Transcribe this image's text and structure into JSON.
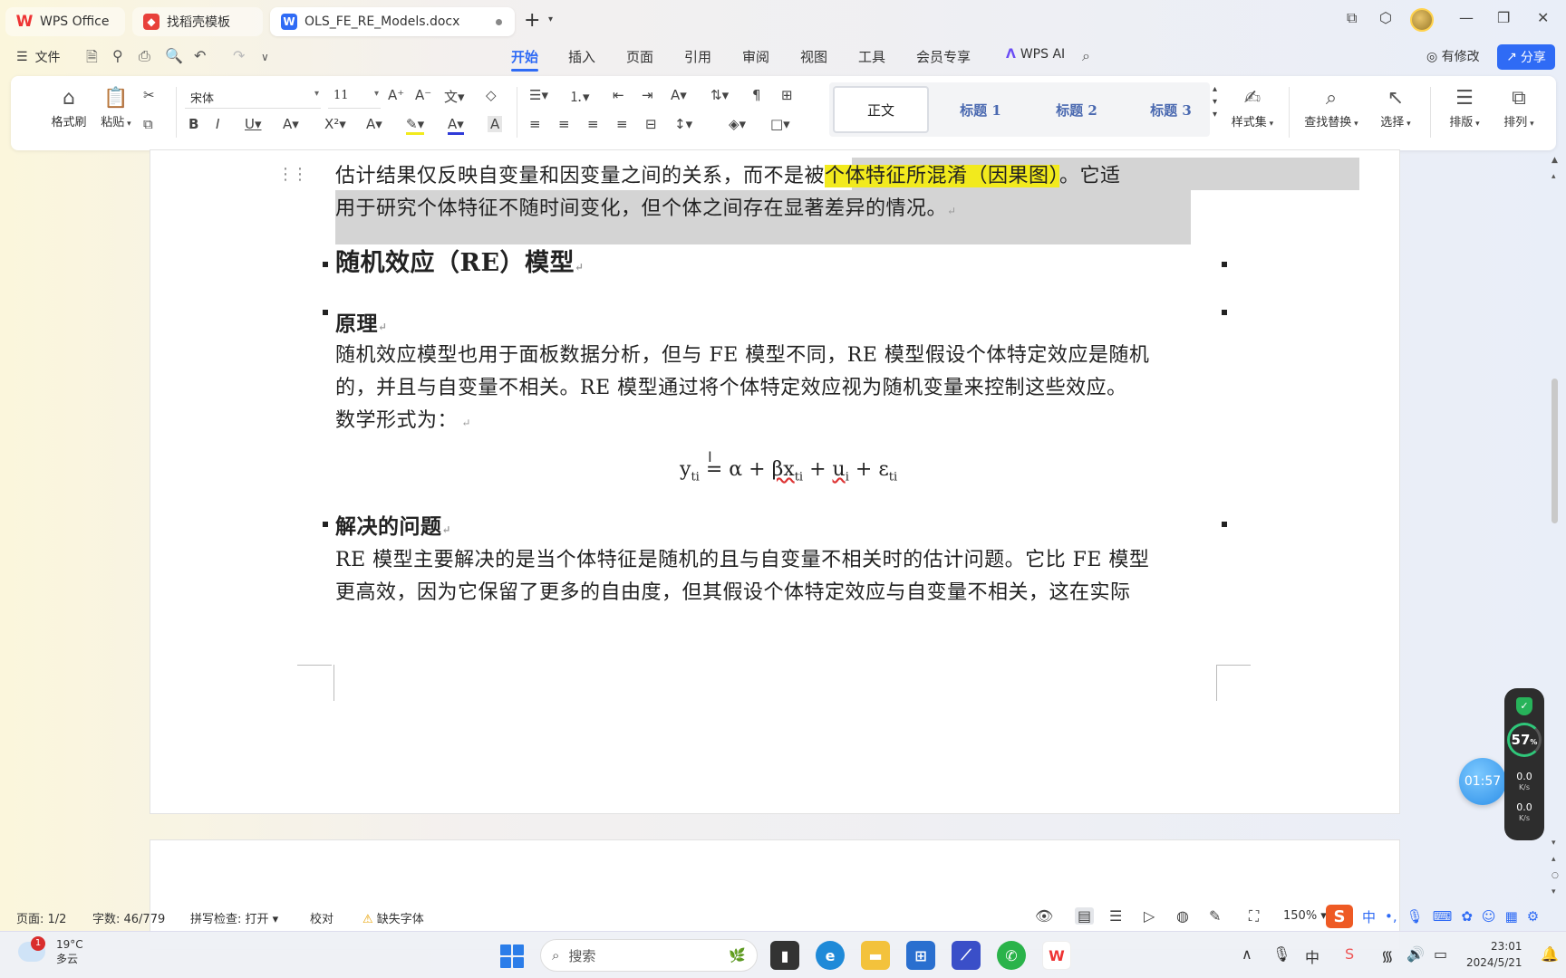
{
  "titlebar": {
    "tabs": [
      {
        "label": "WPS Office"
      },
      {
        "label": "找稻壳模板"
      },
      {
        "label": "OLS_FE_RE_Models.docx"
      }
    ],
    "new_tab": "+"
  },
  "menubar": {
    "file_label": "文件",
    "tabs": [
      "开始",
      "插入",
      "页面",
      "引用",
      "审阅",
      "视图",
      "工具",
      "会员专享"
    ],
    "ai_label": "WPS AI",
    "revise_label": "有修改",
    "share_label": "分享"
  },
  "ribbon": {
    "format_painter": "格式刷",
    "paste": "粘贴",
    "font_name": "宋体",
    "font_size": "11",
    "styles": [
      "正文",
      "标题 1",
      "标题 2",
      "标题 3"
    ],
    "style_set": "样式集",
    "find_replace": "查找替换",
    "select": "选择",
    "typeset": "排版",
    "arrange": "排列"
  },
  "document": {
    "line1_a": "估计结果仅反映自变量和因变量之间的关系，而不是",
    "line1_b": "被",
    "line1_highlight": "个体特征所混淆（因果图）",
    "line1_c": "。它适",
    "line2": "用于研究个体特征不随时间变化，但个体之间存在显著差异的情况。",
    "heading_re": "随机效应（RE）模型",
    "heading_principle": "原理",
    "p1_line1": "随机效应模型也用于面板数据分析，但与 FE 模型不同，RE 模型假设个体特定效应是随机",
    "p1_line2": "的，并且与自变量不相关。RE 模型通过将个体特定效应视为随机变量来控制这些效应。",
    "p1_line3": "数学形式为：",
    "heading_problem": "解决的问题",
    "p2_line1": "RE 模型主要解决的是当个体特征是随机的且与自变量不相关时的估计问题。它比 FE 模型",
    "p2_line2": "更高效，因为它保留了更多的自由度，但其假设个体特定效应与自变量不相关，这在实际"
  },
  "formula": {
    "y": "y",
    "y_sub": "ti",
    "eq": "=",
    "alpha": "α",
    "plus": "+",
    "beta_x": "βx",
    "x_sub": "ti",
    "u": "u",
    "u_sub": "i",
    "eps": "ε",
    "eps_sub": "ti"
  },
  "widget": {
    "cpu": "57",
    "cpu_unit": "%",
    "up": "0.0",
    "up_unit": "K/s",
    "down": "0.0",
    "down_unit": "K/s",
    "timer": "01:57"
  },
  "statusbar": {
    "page": "页面: 1/2",
    "words": "字数: 46/779",
    "spell": "拼写检查: 打开",
    "proof": "校对",
    "missing_font": "缺失字体",
    "zoom": "150%"
  },
  "taskbar": {
    "weather_temp": "19°C",
    "weather_desc": "多云",
    "weather_badge": "1",
    "search_placeholder": "搜索",
    "time": "23:01",
    "date": "2024/5/21"
  },
  "colors": {
    "accent": "#2f6bf5",
    "highlight": "#f2ea1d",
    "selection": "#d4d4d4"
  }
}
